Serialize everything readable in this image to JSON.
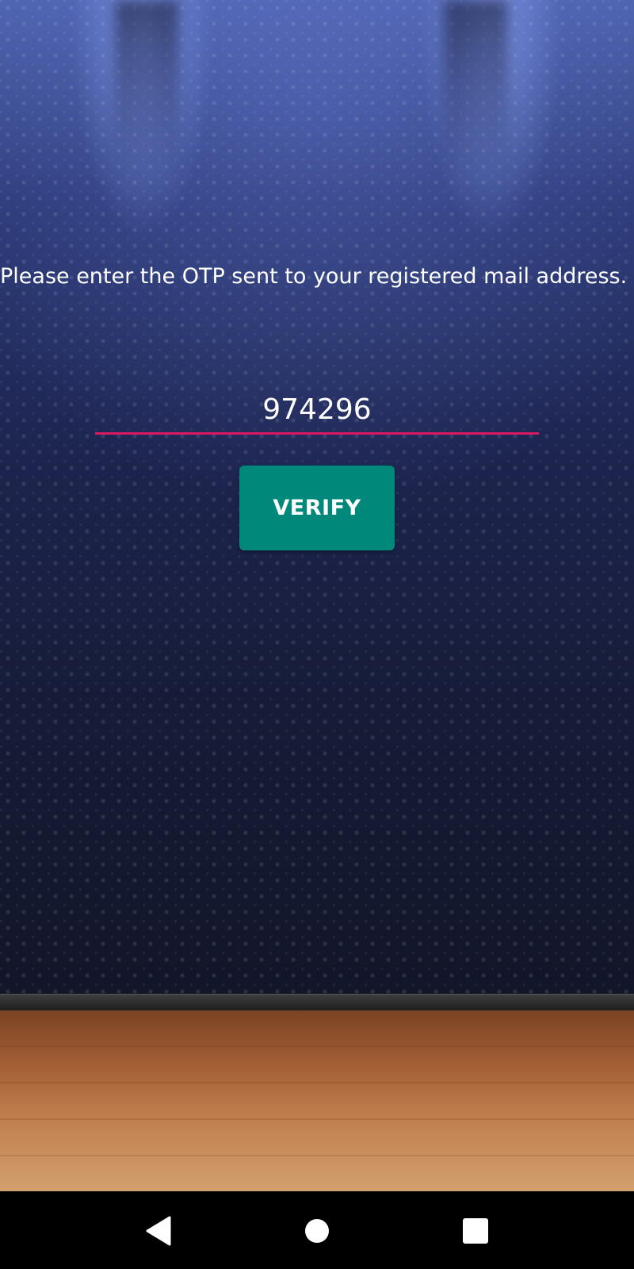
{
  "prompt_text": "Please enter the OTP sent to your registered mail address.",
  "otp_input": {
    "value": "974296",
    "underline_color": "#d81b60"
  },
  "verify_button": {
    "label": "VERIFY",
    "color": "#00897b"
  },
  "nav_bar": {
    "icons": [
      "back-icon",
      "home-icon",
      "recents-icon"
    ]
  }
}
